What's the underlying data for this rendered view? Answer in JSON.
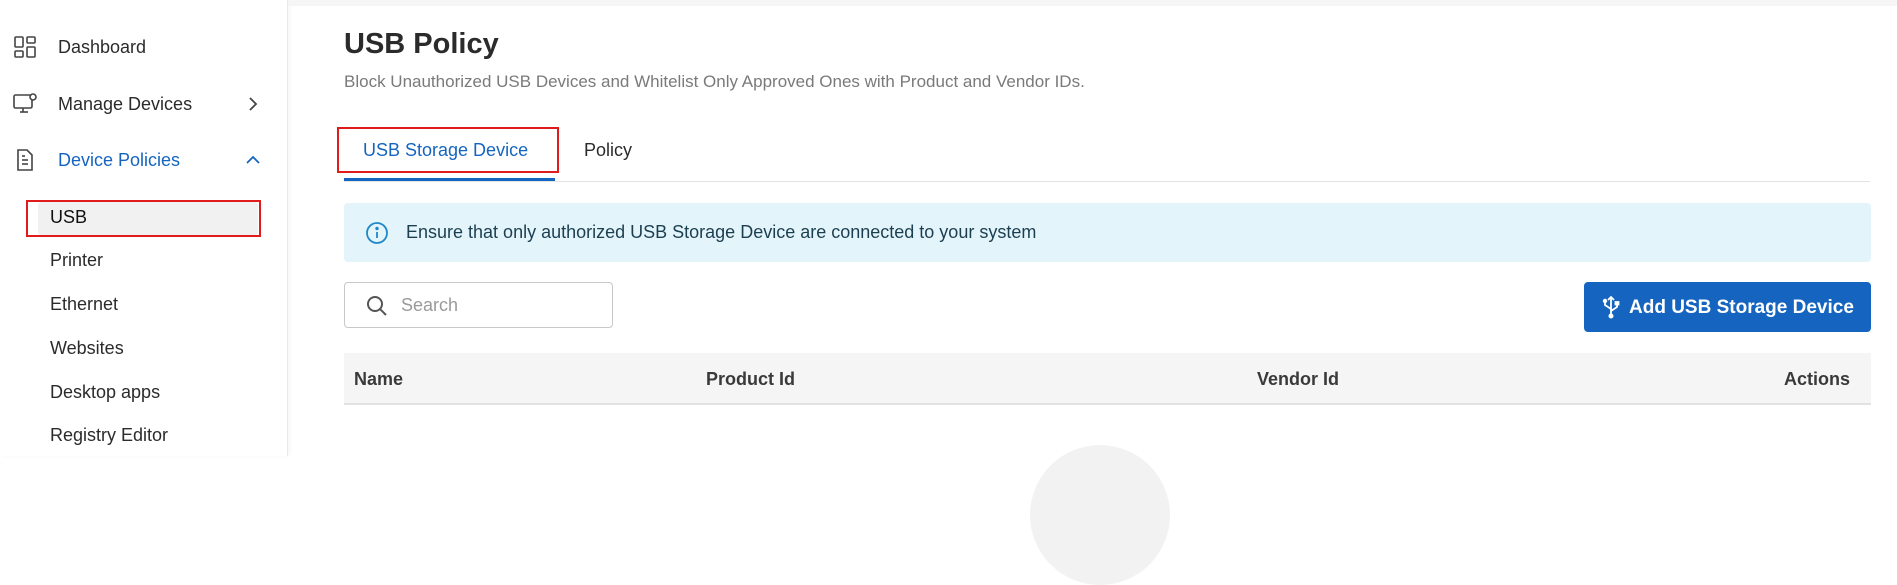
{
  "sidebar": {
    "items": [
      {
        "label": "Dashboard",
        "icon": "dashboard-icon"
      },
      {
        "label": "Manage Devices",
        "icon": "monitor-icon"
      },
      {
        "label": "Device Policies",
        "icon": "document-icon"
      }
    ],
    "sub_items": [
      "USB",
      "Printer",
      "Ethernet",
      "Websites",
      "Desktop apps",
      "Registry Editor"
    ]
  },
  "page": {
    "title": "USB Policy",
    "subtitle": "Block Unauthorized USB Devices and Whitelist Only Approved Ones with Product and Vendor IDs."
  },
  "tabs": [
    {
      "label": "USB Storage Device"
    },
    {
      "label": "Policy"
    }
  ],
  "alert": {
    "text": "Ensure that only authorized USB Storage Device are connected to your system"
  },
  "search": {
    "placeholder": "Search",
    "value": ""
  },
  "add_button": {
    "label": "Add USB Storage Device"
  },
  "table": {
    "columns": [
      "Name",
      "Product Id",
      "Vendor Id",
      "Actions"
    ]
  },
  "colors": {
    "accent": "#1565c0",
    "highlight": "#e01b1b",
    "alert_bg": "#e3f4fb"
  }
}
